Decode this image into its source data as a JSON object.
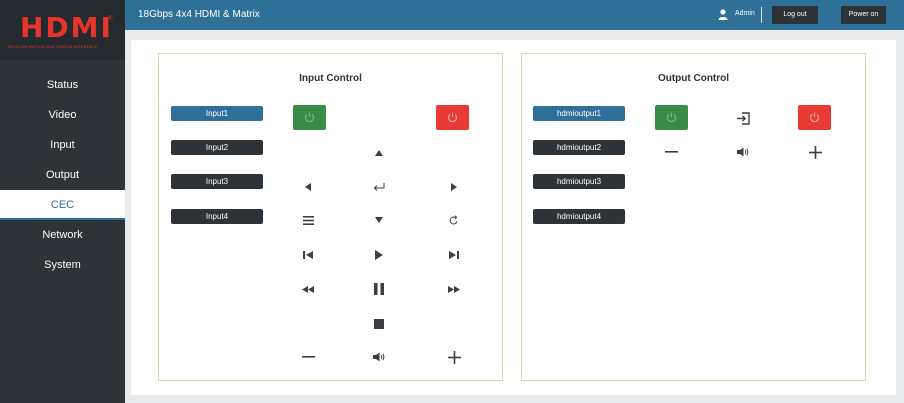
{
  "header": {
    "title": "18Gbps 4x4 HDMI & Matrix",
    "user": "Admin",
    "logout_label": "Log out",
    "power_label": "Power on"
  },
  "logo": {
    "text": "HDMI",
    "registered": "®",
    "tagline": "HIGH-DEFINITION MULTIMEDIA INTERFACE"
  },
  "sidebar": {
    "items": [
      {
        "label": "Status"
      },
      {
        "label": "Video"
      },
      {
        "label": "Input"
      },
      {
        "label": "Output"
      },
      {
        "label": "CEC",
        "active": true
      },
      {
        "label": "Network"
      },
      {
        "label": "System"
      }
    ]
  },
  "input_control": {
    "title": "Input Control",
    "inputs": [
      "Input1",
      "Input2",
      "Input3",
      "Input4"
    ],
    "selected": "Input1",
    "buttons": [
      "power-on",
      "power-off",
      "up",
      "left",
      "enter",
      "right",
      "menu",
      "down",
      "back",
      "previous",
      "play",
      "next",
      "rewind",
      "pause",
      "fast-forward",
      "stop",
      "volume-down",
      "mute",
      "volume-up"
    ]
  },
  "output_control": {
    "title": "Output Control",
    "outputs": [
      "hdmioutput1",
      "hdmioutput2",
      "hdmioutput3",
      "hdmioutput4"
    ],
    "selected": "hdmioutput1",
    "buttons": [
      "power-on",
      "source",
      "power-off",
      "volume-down",
      "mute",
      "volume-up"
    ]
  },
  "colors": {
    "topbar": "#2f7099",
    "sidebar": "#2e3338",
    "accent": "#2f7099",
    "power_on": "#3a8a48",
    "power_off": "#e73b33",
    "logo": "#e6352b"
  }
}
